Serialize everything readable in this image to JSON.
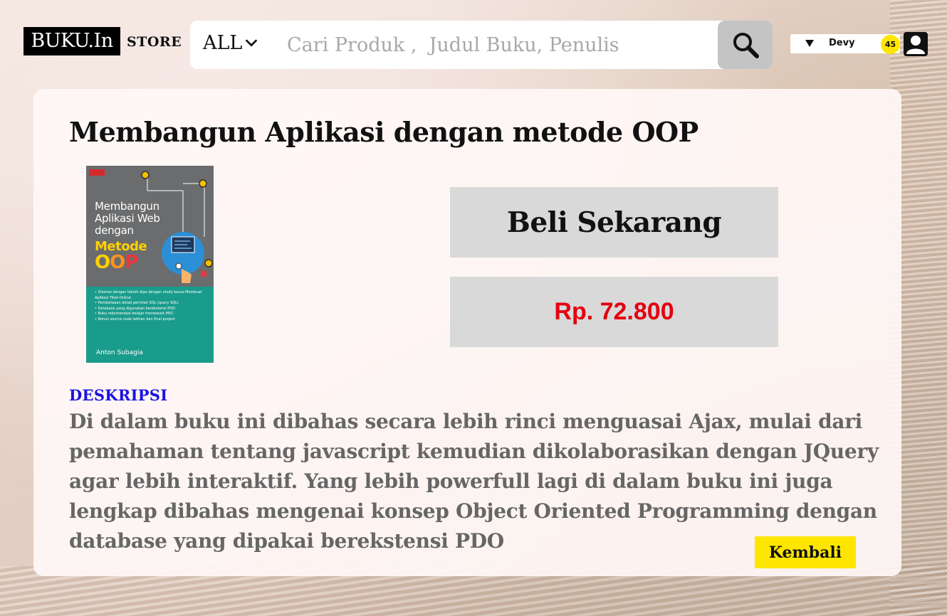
{
  "header": {
    "logo_text": "BUKU.In",
    "store_label": "STORE",
    "search": {
      "category": "ALL",
      "placeholder": "Cari Produk ,  Judul Buku, Penulis",
      "value": ""
    },
    "user": {
      "name": "Devy",
      "badge_count": "45"
    }
  },
  "product": {
    "title": "Membangun Aplikasi dengan metode OOP",
    "buy_label": "Beli Sekarang",
    "price": "Rp. 72.800",
    "cover": {
      "title_line": "Membangun Aplikasi Web dengan",
      "metode": "Metode",
      "oop": [
        "O",
        "O",
        "P"
      ],
      "bullets": [
        "Disertai dengan teknik Ajax dengan study kasus Membuat Aplikasi Tiket-Online",
        "Pembahasan detail perintah SQL (query SQL)",
        "Database yang digunakan berekstensi PDO",
        "Buku rekomendasi belajar framework MVC",
        "Bonus source code latihan dan final project"
      ],
      "author": "Anton Subagia"
    },
    "description": {
      "heading": "DESKRIPSI",
      "text": "Di dalam buku ini dibahas secara lebih rinci menguasai Ajax, mulai dari pemahaman tentang javascript kemudian dikolaborasikan dengan JQuery agar lebih interaktif. Yang lebih powerfull lagi di dalam buku ini juga lengkap dibahas mengenai konsep Object Oriented Programming dengan database yang dipakai berekstensi PDO"
    },
    "back_label": "Kembali"
  },
  "colors": {
    "price": "#e4000f",
    "desc_heading": "#1b12e0",
    "back_button": "#ffe600",
    "badge": "#ffe600"
  }
}
